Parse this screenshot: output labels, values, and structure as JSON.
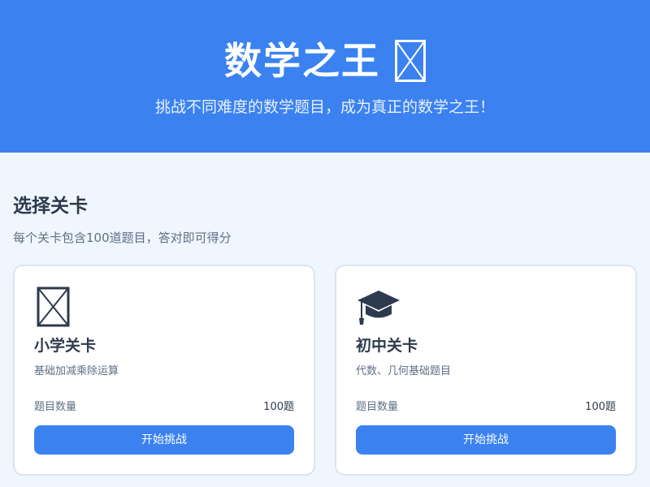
{
  "header": {
    "title": "数学之王",
    "title_icon": "missing-glyph-icon",
    "subtitle": "挑战不同难度的数学题目，成为真正的数学之王！",
    "background": "#3b82f0"
  },
  "main": {
    "section_title": "选择关卡",
    "section_desc": "每个关卡包含100道题目，答对即可得分"
  },
  "cards": [
    {
      "icon": "missing-glyph-icon",
      "title": "小学关卡",
      "desc": "基础加减乘除运算",
      "stat_label": "题目数量",
      "stat_value": "100题",
      "button_label": "开始挑战"
    },
    {
      "icon": "graduation-cap-icon",
      "title": "初中关卡",
      "desc": "代数、几何基础题目",
      "stat_label": "题目数量",
      "stat_value": "100题",
      "button_label": "开始挑战"
    }
  ],
  "colors": {
    "accent": "#3b82f0",
    "page_background": "#f0f6ff",
    "text_dark": "#2d3a4d",
    "text_muted": "#5f6f85"
  }
}
